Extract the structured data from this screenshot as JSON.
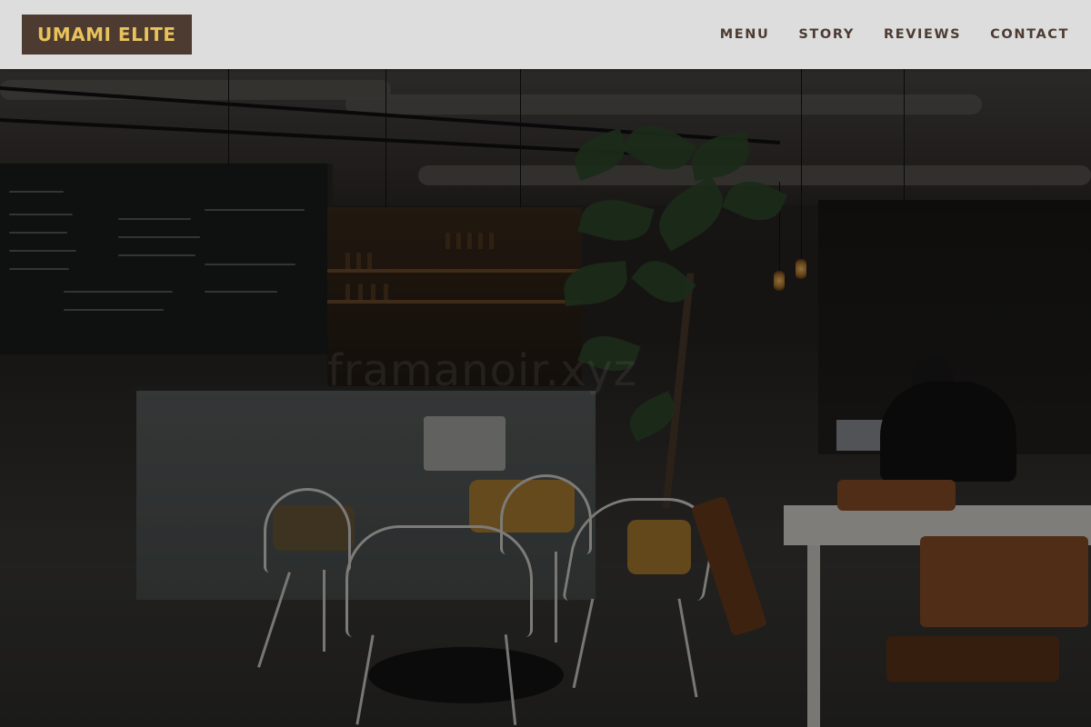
{
  "header": {
    "logo": "UMAMI ELITE",
    "nav": [
      {
        "label": "MENU"
      },
      {
        "label": "STORY"
      },
      {
        "label": "REVIEWS"
      },
      {
        "label": "CONTACT"
      }
    ]
  },
  "hero": {
    "watermark": "framanoir.xyz"
  },
  "colors": {
    "logo_bg": "#4d3b32",
    "logo_text": "#e8c25a",
    "nav_text": "#4d3b32",
    "header_bg": "#e8e8e8"
  }
}
